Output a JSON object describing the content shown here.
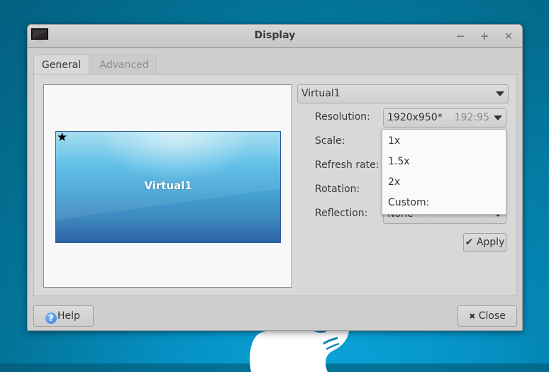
{
  "window": {
    "title": "Display",
    "controls": {
      "minimize": "−",
      "maximize": "+",
      "close": "✕"
    }
  },
  "tabs": [
    {
      "label": "General",
      "active": true
    },
    {
      "label": "Advanced",
      "active": false
    }
  ],
  "preview": {
    "monitor_label": "Virtual1",
    "primary_marker": "★"
  },
  "output": {
    "selected": "Virtual1"
  },
  "fields": {
    "resolution": {
      "label": "Resolution:",
      "value": "1920x950*",
      "ratio": "192:95"
    },
    "scale": {
      "label": "Scale:"
    },
    "refresh_rate": {
      "label": "Refresh rate:"
    },
    "rotation": {
      "label": "Rotation:"
    },
    "reflection": {
      "label": "Reflection:",
      "value": "None"
    }
  },
  "scale_menu": {
    "options": [
      "1x",
      "1.5x",
      "2x",
      "Custom:"
    ]
  },
  "buttons": {
    "apply": {
      "icon": "✔",
      "label": "Apply"
    },
    "help": {
      "icon": "?",
      "label": "Help"
    },
    "close": {
      "icon": "✖",
      "label": "Close"
    }
  }
}
